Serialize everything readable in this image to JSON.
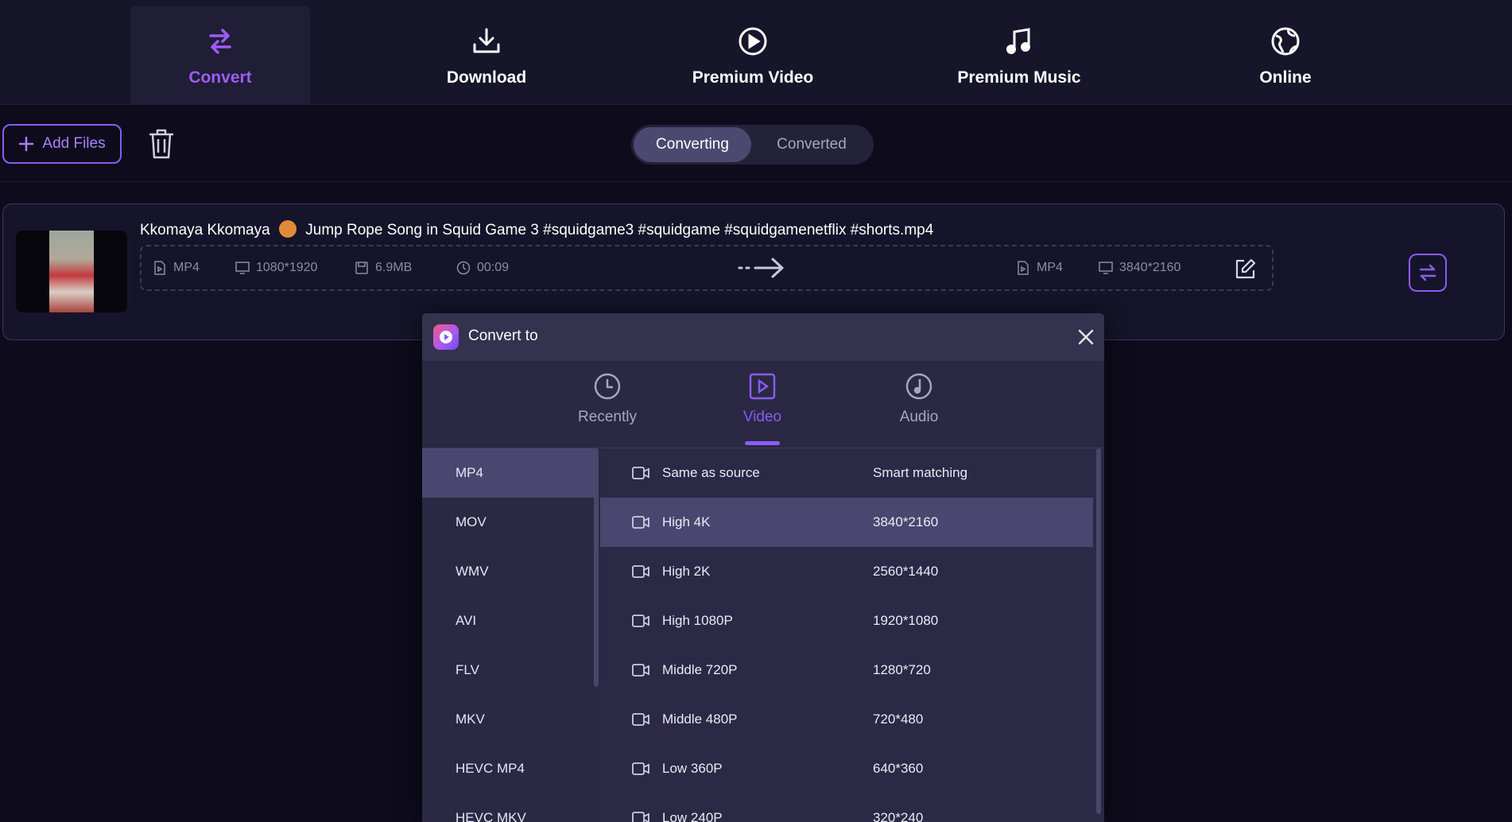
{
  "nav": {
    "tabs": [
      {
        "label": "Convert",
        "icon": "convert-arrows-icon",
        "active": true
      },
      {
        "label": "Download",
        "icon": "download-icon"
      },
      {
        "label": "Premium Video",
        "icon": "play-circle-icon"
      },
      {
        "label": "Premium Music",
        "icon": "music-note-icon"
      },
      {
        "label": "Online",
        "icon": "globe-icon"
      }
    ]
  },
  "toolbar": {
    "add_files_label": "Add Files",
    "segments": {
      "converting": "Converting",
      "converted": "Converted"
    }
  },
  "file": {
    "name_prefix": "Kkomaya Kkomaya",
    "name_suffix": "Jump Rope Song in Squid Game 3 #squidgame3  #squidgame #squidgamenetflix #shorts.mp4",
    "source": {
      "format": "MP4",
      "resolution": "1080*1920",
      "size": "6.9MB",
      "duration": "00:09"
    },
    "target": {
      "format": "MP4",
      "resolution": "3840*2160"
    }
  },
  "dialog": {
    "title": "Convert to",
    "categories": {
      "recently": "Recently",
      "video": "Video",
      "audio": "Audio"
    },
    "formats": [
      "MP4",
      "MOV",
      "WMV",
      "AVI",
      "FLV",
      "MKV",
      "HEVC MP4",
      "HEVC MKV"
    ],
    "options": [
      {
        "name": "Same as source",
        "res": "Smart matching"
      },
      {
        "name": "High 4K",
        "res": "3840*2160"
      },
      {
        "name": "High 2K",
        "res": "2560*1440"
      },
      {
        "name": "High 1080P",
        "res": "1920*1080"
      },
      {
        "name": "Middle 720P",
        "res": "1280*720"
      },
      {
        "name": "Middle 480P",
        "res": "720*480"
      },
      {
        "name": "Low 360P",
        "res": "640*360"
      },
      {
        "name": "Low 240P",
        "res": "320*240"
      }
    ]
  },
  "colors": {
    "accent": "#8b5cf6",
    "background": "#0e0c1c",
    "panel": "#2a2843"
  }
}
